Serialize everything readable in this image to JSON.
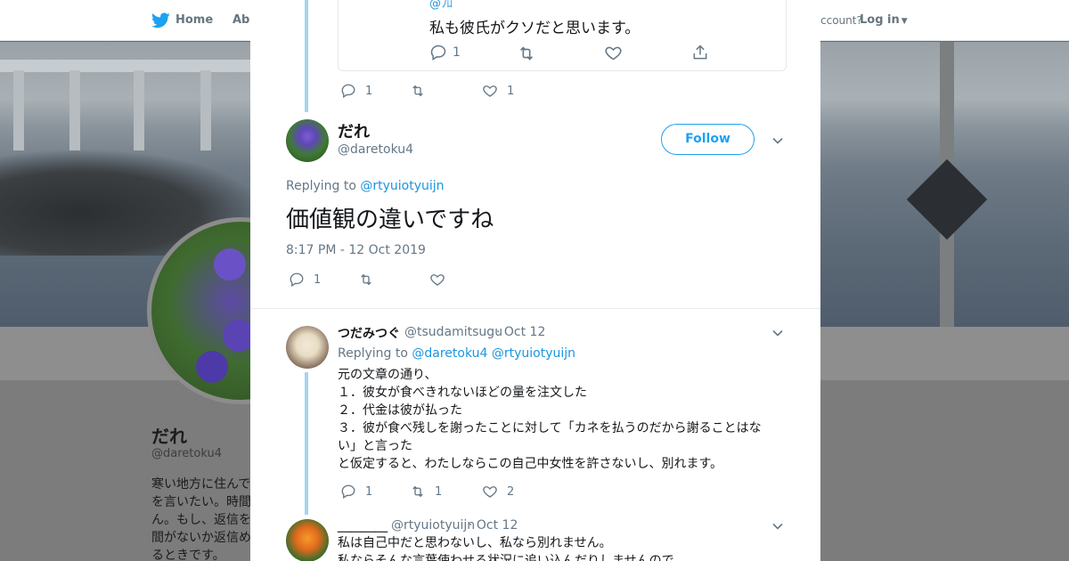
{
  "nav": {
    "home_label": "Home",
    "about_label": "Abo",
    "account_text": "ccount?",
    "login_label": "Log in"
  },
  "profile": {
    "name": "だれ",
    "handle": "@daretoku4",
    "bio": "寒い地方に住んで\nを言いたい。時間\nん。もし、返信を\n間がないか返信め\nるときです。"
  },
  "quoted_tweet": {
    "partial_top": "@ﾌﾛ",
    "text": "私も彼氏がクソだと思います。",
    "reply_count": "1"
  },
  "parent_actions": {
    "reply_count": "1",
    "retweet_count": "",
    "like_count": "1"
  },
  "main_tweet": {
    "name": "だれ",
    "handle": "@daretoku4",
    "follow_label": "Follow",
    "replying_prefix": "Replying to",
    "replying_to": "@rtyuiotyuijn",
    "text": "価値観の違いですね",
    "timestamp": "8:17 PM - 12 Oct 2019",
    "reply_count": "1",
    "retweet_count": "",
    "like_count": ""
  },
  "replies": [
    {
      "name": "つだみつぐ",
      "handle": "@tsudamitsugu",
      "date": "· Oct 12",
      "replying_prefix": "Replying to",
      "replying_to_1": "@daretoku4",
      "replying_to_2": "@rtyuiotyuijn",
      "lines": [
        "元の文章の通り、",
        "１．彼女が食べきれないほどの量を注文した",
        "２．代金は彼が払った",
        "３．彼が食べ残しを謝ったことに対して「カネを払うのだから謝ることはな",
        "い」と言った",
        "と仮定すると、わたしならこの自己中女性を許さないし、別れます。"
      ],
      "reply_count": "1",
      "retweet_count": "1",
      "like_count": "2"
    },
    {
      "name": "＿＿＿＿",
      "handle": "@rtyuiotyuijn",
      "date": "· Oct 12",
      "lines": [
        "私は自己中だと思わないし、私なら別れません。",
        "私ならそんな言葉使わせる状況に追い込んだりしませんので"
      ]
    }
  ],
  "colors": {
    "accent": "#1da1f2",
    "thread_line": "#a7d3f0",
    "muted": "#657786"
  }
}
